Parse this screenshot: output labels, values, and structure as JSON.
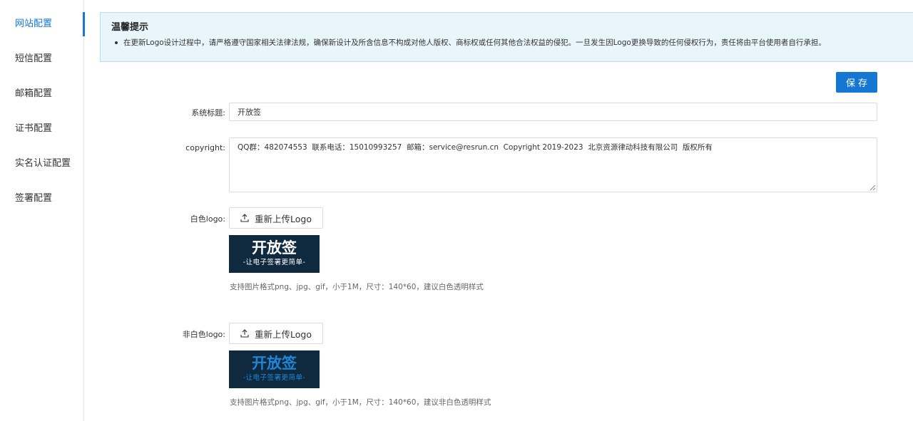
{
  "sidebar": {
    "items": [
      {
        "label": "网站配置",
        "active": true
      },
      {
        "label": "短信配置",
        "active": false
      },
      {
        "label": "邮箱配置",
        "active": false
      },
      {
        "label": "证书配置",
        "active": false
      },
      {
        "label": "实名认证配置",
        "active": false
      },
      {
        "label": "签署配置",
        "active": false
      }
    ]
  },
  "alert": {
    "title": "温馨提示",
    "text": "在更新Logo设计过程中，请严格遵守国家相关法律法规，确保新设计及所含信息不构成对他人版权、商标权或任何其他合法权益的侵犯。一旦发生因Logo更换导致的任何侵权行为，责任将由平台使用者自行承担。"
  },
  "toolbar": {
    "save_label": "保存"
  },
  "form": {
    "system_title": {
      "label": "系统标题:",
      "value": "开放签"
    },
    "copyright": {
      "label": "copyright:",
      "value": "QQ群：482074553  联系电话：15010993257  邮箱：service@resrun.cn  Copyright 2019-2023  北京资源律动科技有限公司  版权所有"
    },
    "white_logo": {
      "label": "白色logo:",
      "upload_label": "重新上传Logo",
      "logo_main": "开放签",
      "logo_sub": "-让电子签署更简单-",
      "hint": "支持图片格式png、jpg、gif，小于1M，尺寸：140*60，建议白色透明样式"
    },
    "color_logo": {
      "label": "非白色logo:",
      "upload_label": "重新上传Logo",
      "logo_main": "开放签",
      "logo_sub": "-让电子签署更简单-",
      "hint": "支持图片格式png、jpg、gif，小于1M，尺寸：140*60，建议非白色透明样式"
    }
  },
  "colors": {
    "accent": "#1677d2",
    "logo_bg": "#0f2a3f",
    "white_logo_text": "#ffffff",
    "color_logo_text": "#1f86d9"
  }
}
